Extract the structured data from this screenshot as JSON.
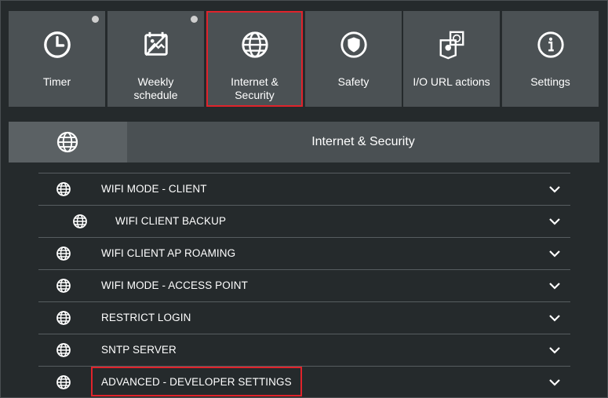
{
  "tiles": [
    {
      "label": "Timer",
      "icon": "clock-icon",
      "badge": true,
      "selected": false
    },
    {
      "label": "Weekly\nschedule",
      "icon": "schedule-icon",
      "badge": true,
      "selected": false
    },
    {
      "label": "Internet &\nSecurity",
      "icon": "globe-icon",
      "badge": false,
      "selected": true
    },
    {
      "label": "Safety",
      "icon": "shield-icon",
      "badge": false,
      "selected": false
    },
    {
      "label": "I/O URL actions",
      "icon": "url-actions-icon",
      "badge": false,
      "selected": false
    },
    {
      "label": "Settings",
      "icon": "info-icon",
      "badge": false,
      "selected": false
    }
  ],
  "section": {
    "title": "Internet & Security",
    "icon": "globe-icon"
  },
  "items": [
    {
      "label": "WIFI MODE - CLIENT",
      "sub": false,
      "highlighted": false
    },
    {
      "label": "WIFI CLIENT BACKUP",
      "sub": true,
      "highlighted": false
    },
    {
      "label": "WIFI CLIENT AP ROAMING",
      "sub": false,
      "highlighted": false
    },
    {
      "label": "WIFI MODE - ACCESS POINT",
      "sub": false,
      "highlighted": false
    },
    {
      "label": "RESTRICT LOGIN",
      "sub": false,
      "highlighted": false
    },
    {
      "label": "SNTP SERVER",
      "sub": false,
      "highlighted": false
    },
    {
      "label": "ADVANCED - DEVELOPER SETTINGS",
      "sub": false,
      "highlighted": true
    }
  ],
  "colors": {
    "highlight": "#e0232b",
    "tile_bg": "#4b5154",
    "page_bg": "#252a2c"
  }
}
